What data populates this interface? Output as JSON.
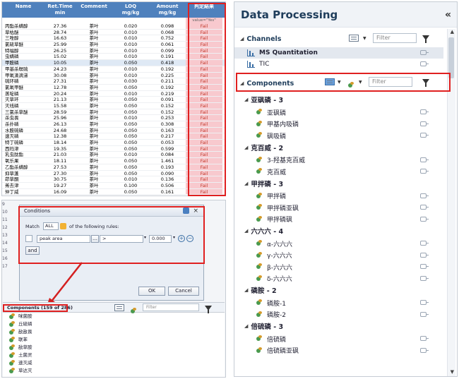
{
  "results": {
    "columns": [
      "Name",
      "Ret.Time\nmin",
      "Comment",
      "LOQ\nmg/kg",
      "Amount\nmg/kg",
      "判定結果"
    ],
    "filter_text": "value=\"Yes\"",
    "rows": [
      {
        "name": "丙酯杀螨醇",
        "rt": "27.36",
        "comment": "茶叶",
        "loq": "0.020",
        "amount": "0.098",
        "result": "Fail"
      },
      {
        "name": "草枯醚",
        "rt": "28.74",
        "comment": "茶叶",
        "loq": "0.010",
        "amount": "0.068",
        "result": "Fail"
      },
      {
        "name": "三唑醇",
        "rt": "16.63",
        "comment": "茶叶",
        "loq": "0.010",
        "amount": "0.752",
        "result": "Fail"
      },
      {
        "name": "氯硫草醚",
        "rt": "25.99",
        "comment": "茶叶",
        "loq": "0.010",
        "amount": "0.061",
        "result": "Fail"
      },
      {
        "name": "特福醇",
        "rt": "26.25",
        "comment": "茶叶",
        "loq": "0.010",
        "amount": "0.099",
        "result": "Fail"
      },
      {
        "name": "虫螨磷",
        "rt": "15.02",
        "comment": "茶叶",
        "loq": "0.010",
        "amount": "0.191",
        "result": "Fail"
      },
      {
        "name": "甲胺磷",
        "rt": "10.05",
        "comment": "茶叶",
        "loq": "0.050",
        "amount": "0.418",
        "result": "Fail"
      },
      {
        "name": "甲基杀螟硫",
        "rt": "24.23",
        "comment": "茶叶",
        "loq": "0.010",
        "amount": "0.192",
        "result": "Fail"
      },
      {
        "name": "甲氧滴滴涕",
        "rt": "30.08",
        "comment": "茶叶",
        "loq": "0.010",
        "amount": "0.225",
        "result": "Fail"
      },
      {
        "name": "硫环磷",
        "rt": "27.31",
        "comment": "茶叶",
        "loq": "0.030",
        "amount": "0.211",
        "result": "Fail"
      },
      {
        "name": "氯氧甲醚",
        "rt": "12.78",
        "comment": "茶叶",
        "loq": "0.050",
        "amount": "0.192",
        "result": "Fail"
      },
      {
        "name": "蒸啶磷",
        "rt": "20.24",
        "comment": "茶叶",
        "loq": "0.010",
        "amount": "0.219",
        "result": "Fail"
      },
      {
        "name": "灭草环",
        "rt": "21.13",
        "comment": "茶叶",
        "loq": "0.050",
        "amount": "0.091",
        "result": "Fail"
      },
      {
        "name": "灭线磷",
        "rt": "15.58",
        "comment": "茶叶",
        "loq": "0.050",
        "amount": "0.152",
        "result": "Fail"
      },
      {
        "name": "三氯杀草醚",
        "rt": "28.59",
        "comment": "茶叶",
        "loq": "0.050",
        "amount": "0.152",
        "result": "Fail"
      },
      {
        "name": "杀虫畏",
        "rt": "25.96",
        "comment": "茶叶",
        "loq": "0.010",
        "amount": "0.253",
        "result": "Fail"
      },
      {
        "name": "杀扑磷",
        "rt": "26.13",
        "comment": "茶叶",
        "loq": "0.050",
        "amount": "0.308",
        "result": "Fail"
      },
      {
        "name": "水胺硫磷",
        "rt": "24.68",
        "comment": "茶叶",
        "loq": "0.050",
        "amount": "0.163",
        "result": "Fail"
      },
      {
        "name": "速灭磷",
        "rt": "12.38",
        "comment": "茶叶",
        "loq": "0.050",
        "amount": "0.217",
        "result": "Fail"
      },
      {
        "name": "特丁硫磷",
        "rt": "18.14",
        "comment": "茶叶",
        "loq": "0.050",
        "amount": "0.053",
        "result": "Fail"
      },
      {
        "name": "西玛津",
        "rt": "19.35",
        "comment": "茶叶",
        "loq": "0.050",
        "amount": "0.599",
        "result": "Fail"
      },
      {
        "name": "乳虫肽酯",
        "rt": "21.03",
        "comment": "茶叶",
        "loq": "0.010",
        "amount": "0.084",
        "result": "Fail"
      },
      {
        "name": "氧乐果",
        "rt": "18.11",
        "comment": "茶叶",
        "loq": "0.050",
        "amount": "1.461",
        "result": "Fail"
      },
      {
        "name": "乙酯杀螨醇",
        "rt": "27.53",
        "comment": "茶叶",
        "loq": "0.050",
        "amount": "0.193",
        "result": "Fail"
      },
      {
        "name": "抑草蓬",
        "rt": "27.30",
        "comment": "茶叶",
        "loq": "0.050",
        "amount": "0.090",
        "result": "Fail"
      },
      {
        "name": "茚草酮",
        "rt": "30.75",
        "comment": "茶叶",
        "loq": "0.010",
        "amount": "0.136",
        "result": "Fail"
      },
      {
        "name": "莠去津",
        "rt": "19.27",
        "comment": "茶叶",
        "loq": "0.100",
        "amount": "0.506",
        "result": "Fail"
      },
      {
        "name": "仲丁威",
        "rt": "16.09",
        "comment": "茶叶",
        "loq": "0.050",
        "amount": "0.161",
        "result": "Fail"
      }
    ]
  },
  "conditions": {
    "title": "Conditions",
    "match_prefix": "Match",
    "match_value": "ALL",
    "match_suffix": "of the following rules:",
    "rule_field": "peak area",
    "rule_operator": ">",
    "rule_value": "0.000",
    "and_label": "and",
    "ok_label": "OK",
    "cancel_label": "Cancel",
    "side_numbers": [
      "9",
      "10",
      "11",
      "12",
      "13",
      "14",
      "15",
      "16",
      "17"
    ]
  },
  "small_components": {
    "header": "Components (159 of 286)",
    "filter_placeholder": "Filter",
    "items": [
      "咪菌胺",
      "丘硫磷",
      "敌敌畏",
      "联苯",
      "敌草胺",
      "土菌灵",
      "速灭威",
      "草达灭"
    ]
  },
  "data_processing": {
    "title": "Data Processing",
    "collapse": "«",
    "channels_label": "Channels",
    "filter_placeholder": "Filter",
    "channels": [
      "MS Quantitation",
      "TIC"
    ],
    "components_label": "Components",
    "groups": [
      {
        "name": "亚砜磷 - 3",
        "items": [
          "亚砜磷",
          "甲基内吸磷",
          "砜吸磷"
        ]
      },
      {
        "name": "克百威 - 2",
        "items": [
          "3-羟基克百威",
          "克百威"
        ]
      },
      {
        "name": "甲拌磷 - 3",
        "items": [
          "甲拌磷",
          "甲拌磷亚砜",
          "甲拌磷砜"
        ]
      },
      {
        "name": "六六六 - 4",
        "items": [
          "α-六六六",
          "γ-六六六",
          "β-六六六",
          "δ-六六六"
        ]
      },
      {
        "name": "磷胺 - 2",
        "items": [
          "磷胺-1",
          "磷胺-2"
        ]
      },
      {
        "name": "倍硫磷 - 3",
        "items": [
          "倍硫磷",
          "倍硫磷亚砜"
        ]
      }
    ]
  }
}
